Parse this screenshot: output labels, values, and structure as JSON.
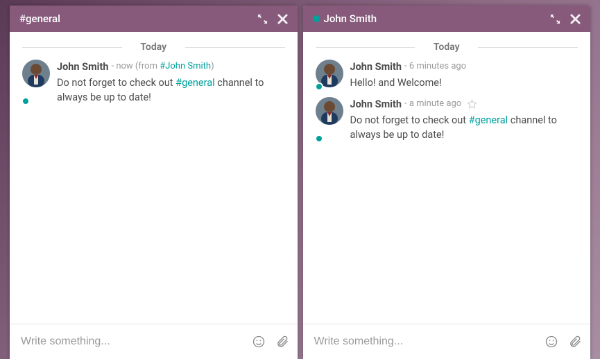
{
  "panels": [
    {
      "title": "#general",
      "has_presence": false,
      "date_separator": "Today",
      "composer_placeholder": "Write something...",
      "messages": [
        {
          "author": "John Smith",
          "meta_prefix": "- now (from ",
          "meta_link": "#John Smith",
          "meta_suffix": ")",
          "show_star": false,
          "body_parts": [
            "Do not forget to check out ",
            "#general",
            " channel to always be up to date!"
          ]
        }
      ]
    },
    {
      "title": "John Smith",
      "has_presence": true,
      "date_separator": "Today",
      "composer_placeholder": "Write something...",
      "messages": [
        {
          "author": "John Smith",
          "meta_prefix": "- 6 minutes ago",
          "meta_link": "",
          "meta_suffix": "",
          "show_star": false,
          "body_parts": [
            "Hello! and Welcome!"
          ]
        },
        {
          "author": "John Smith",
          "meta_prefix": "- a minute ago",
          "meta_link": "",
          "meta_suffix": "",
          "show_star": true,
          "body_parts": [
            "Do not forget to check out ",
            "#general",
            " channel to always be up to date!"
          ]
        }
      ]
    }
  ]
}
